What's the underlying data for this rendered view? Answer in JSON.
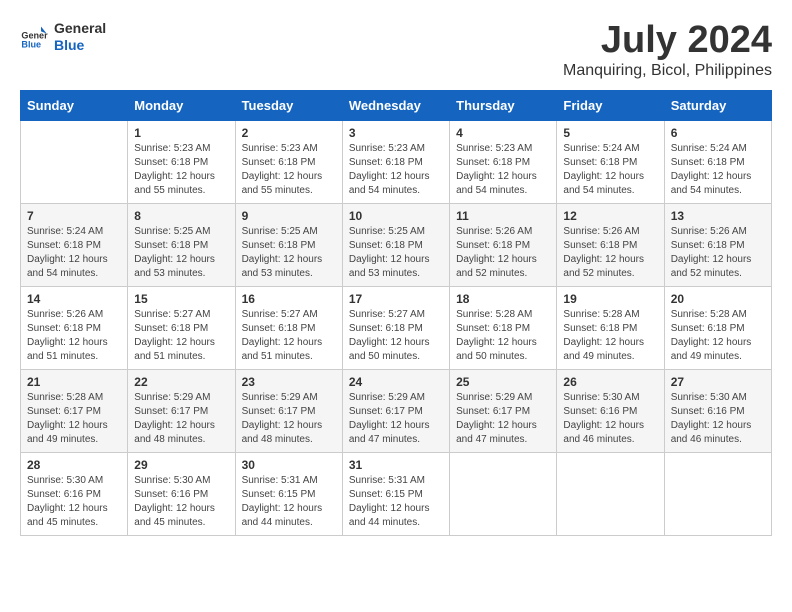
{
  "logo": {
    "line1": "General",
    "line2": "Blue"
  },
  "title": {
    "month_year": "July 2024",
    "location": "Manquiring, Bicol, Philippines"
  },
  "days_of_week": [
    "Sunday",
    "Monday",
    "Tuesday",
    "Wednesday",
    "Thursday",
    "Friday",
    "Saturday"
  ],
  "weeks": [
    [
      {
        "day": "",
        "info": ""
      },
      {
        "day": "1",
        "info": "Sunrise: 5:23 AM\nSunset: 6:18 PM\nDaylight: 12 hours\nand 55 minutes."
      },
      {
        "day": "2",
        "info": "Sunrise: 5:23 AM\nSunset: 6:18 PM\nDaylight: 12 hours\nand 55 minutes."
      },
      {
        "day": "3",
        "info": "Sunrise: 5:23 AM\nSunset: 6:18 PM\nDaylight: 12 hours\nand 54 minutes."
      },
      {
        "day": "4",
        "info": "Sunrise: 5:23 AM\nSunset: 6:18 PM\nDaylight: 12 hours\nand 54 minutes."
      },
      {
        "day": "5",
        "info": "Sunrise: 5:24 AM\nSunset: 6:18 PM\nDaylight: 12 hours\nand 54 minutes."
      },
      {
        "day": "6",
        "info": "Sunrise: 5:24 AM\nSunset: 6:18 PM\nDaylight: 12 hours\nand 54 minutes."
      }
    ],
    [
      {
        "day": "7",
        "info": "Sunrise: 5:24 AM\nSunset: 6:18 PM\nDaylight: 12 hours\nand 54 minutes."
      },
      {
        "day": "8",
        "info": "Sunrise: 5:25 AM\nSunset: 6:18 PM\nDaylight: 12 hours\nand 53 minutes."
      },
      {
        "day": "9",
        "info": "Sunrise: 5:25 AM\nSunset: 6:18 PM\nDaylight: 12 hours\nand 53 minutes."
      },
      {
        "day": "10",
        "info": "Sunrise: 5:25 AM\nSunset: 6:18 PM\nDaylight: 12 hours\nand 53 minutes."
      },
      {
        "day": "11",
        "info": "Sunrise: 5:26 AM\nSunset: 6:18 PM\nDaylight: 12 hours\nand 52 minutes."
      },
      {
        "day": "12",
        "info": "Sunrise: 5:26 AM\nSunset: 6:18 PM\nDaylight: 12 hours\nand 52 minutes."
      },
      {
        "day": "13",
        "info": "Sunrise: 5:26 AM\nSunset: 6:18 PM\nDaylight: 12 hours\nand 52 minutes."
      }
    ],
    [
      {
        "day": "14",
        "info": "Sunrise: 5:26 AM\nSunset: 6:18 PM\nDaylight: 12 hours\nand 51 minutes."
      },
      {
        "day": "15",
        "info": "Sunrise: 5:27 AM\nSunset: 6:18 PM\nDaylight: 12 hours\nand 51 minutes."
      },
      {
        "day": "16",
        "info": "Sunrise: 5:27 AM\nSunset: 6:18 PM\nDaylight: 12 hours\nand 51 minutes."
      },
      {
        "day": "17",
        "info": "Sunrise: 5:27 AM\nSunset: 6:18 PM\nDaylight: 12 hours\nand 50 minutes."
      },
      {
        "day": "18",
        "info": "Sunrise: 5:28 AM\nSunset: 6:18 PM\nDaylight: 12 hours\nand 50 minutes."
      },
      {
        "day": "19",
        "info": "Sunrise: 5:28 AM\nSunset: 6:18 PM\nDaylight: 12 hours\nand 49 minutes."
      },
      {
        "day": "20",
        "info": "Sunrise: 5:28 AM\nSunset: 6:18 PM\nDaylight: 12 hours\nand 49 minutes."
      }
    ],
    [
      {
        "day": "21",
        "info": "Sunrise: 5:28 AM\nSunset: 6:17 PM\nDaylight: 12 hours\nand 49 minutes."
      },
      {
        "day": "22",
        "info": "Sunrise: 5:29 AM\nSunset: 6:17 PM\nDaylight: 12 hours\nand 48 minutes."
      },
      {
        "day": "23",
        "info": "Sunrise: 5:29 AM\nSunset: 6:17 PM\nDaylight: 12 hours\nand 48 minutes."
      },
      {
        "day": "24",
        "info": "Sunrise: 5:29 AM\nSunset: 6:17 PM\nDaylight: 12 hours\nand 47 minutes."
      },
      {
        "day": "25",
        "info": "Sunrise: 5:29 AM\nSunset: 6:17 PM\nDaylight: 12 hours\nand 47 minutes."
      },
      {
        "day": "26",
        "info": "Sunrise: 5:30 AM\nSunset: 6:16 PM\nDaylight: 12 hours\nand 46 minutes."
      },
      {
        "day": "27",
        "info": "Sunrise: 5:30 AM\nSunset: 6:16 PM\nDaylight: 12 hours\nand 46 minutes."
      }
    ],
    [
      {
        "day": "28",
        "info": "Sunrise: 5:30 AM\nSunset: 6:16 PM\nDaylight: 12 hours\nand 45 minutes."
      },
      {
        "day": "29",
        "info": "Sunrise: 5:30 AM\nSunset: 6:16 PM\nDaylight: 12 hours\nand 45 minutes."
      },
      {
        "day": "30",
        "info": "Sunrise: 5:31 AM\nSunset: 6:15 PM\nDaylight: 12 hours\nand 44 minutes."
      },
      {
        "day": "31",
        "info": "Sunrise: 5:31 AM\nSunset: 6:15 PM\nDaylight: 12 hours\nand 44 minutes."
      },
      {
        "day": "",
        "info": ""
      },
      {
        "day": "",
        "info": ""
      },
      {
        "day": "",
        "info": ""
      }
    ]
  ]
}
